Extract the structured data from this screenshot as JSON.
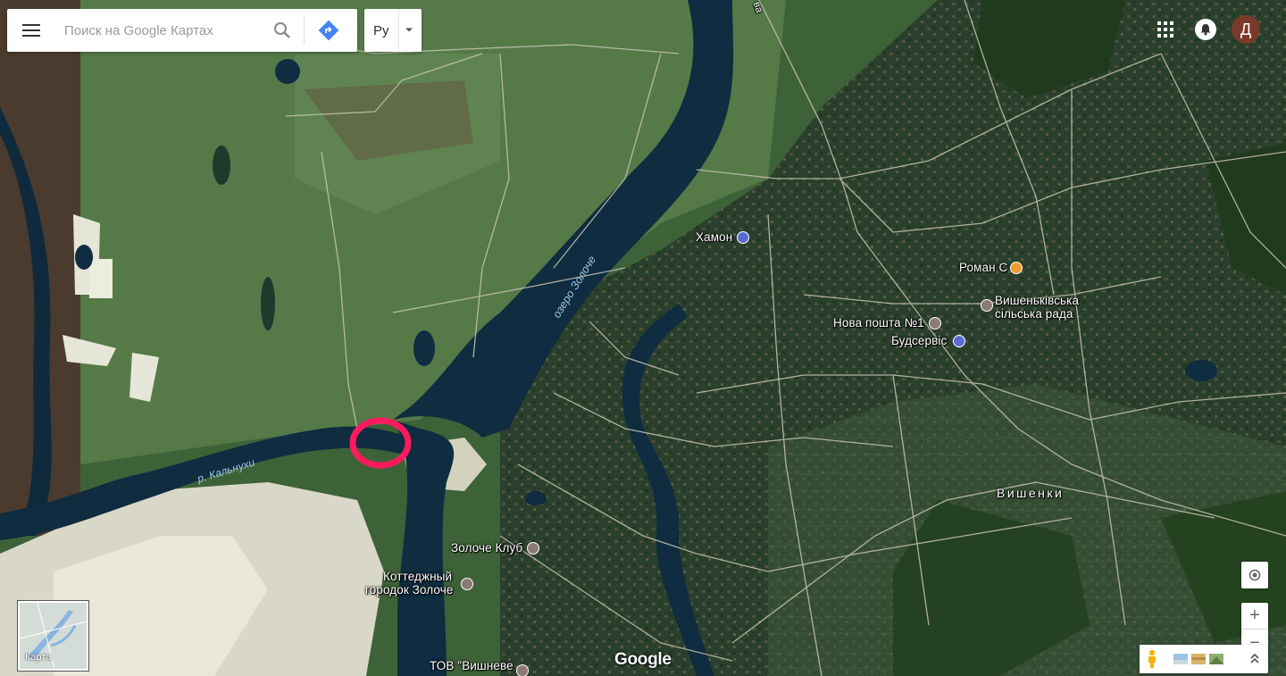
{
  "search": {
    "placeholder": "Поиск на Google Картах"
  },
  "language": {
    "selected": "Ру"
  },
  "account": {
    "avatar_letter": "Д"
  },
  "places": [
    {
      "id": "hamon",
      "name": "Хамон",
      "kind": "shop",
      "color": "#5b6bd6"
    },
    {
      "id": "roman",
      "name": "Роман С",
      "kind": "restaurant",
      "color": "#f29a2e"
    },
    {
      "id": "vyshenkivska",
      "name": "Вишеньківська сільська рада",
      "lines": [
        "Вишеньківська",
        "сільська рада"
      ],
      "kind": "government",
      "color": "#8c7b74"
    },
    {
      "id": "nova-poshta",
      "name": "Нова пошта №1",
      "kind": "post",
      "color": "#8c7b74"
    },
    {
      "id": "budservis",
      "name": "Будсервіс",
      "kind": "store",
      "color": "#5b6bd6"
    },
    {
      "id": "zoloche-club",
      "name": "Золоче Клуб",
      "kind": "venue",
      "color": "#8c7b74"
    },
    {
      "id": "cottage-town",
      "name": "Коттеджный городок Золоче",
      "lines": [
        "Коттеджный",
        "городок Золоче"
      ],
      "kind": "venue",
      "color": "#8c7b74"
    },
    {
      "id": "tov-vyshneve",
      "name": "ТОВ \"Вишневе",
      "kind": "business",
      "color": "#8c7b74"
    }
  ],
  "water_labels": {
    "lake": "озеро Золоче",
    "river": "р. Кальнухи"
  },
  "locality": "Вишенки",
  "road_label": "ва",
  "minimap": {
    "label": "Карта"
  },
  "branding": {
    "logo": "Google"
  },
  "controls": {
    "zoom_in": "+",
    "zoom_out": "−"
  },
  "annotation": {
    "color": "#ff1a5e"
  }
}
